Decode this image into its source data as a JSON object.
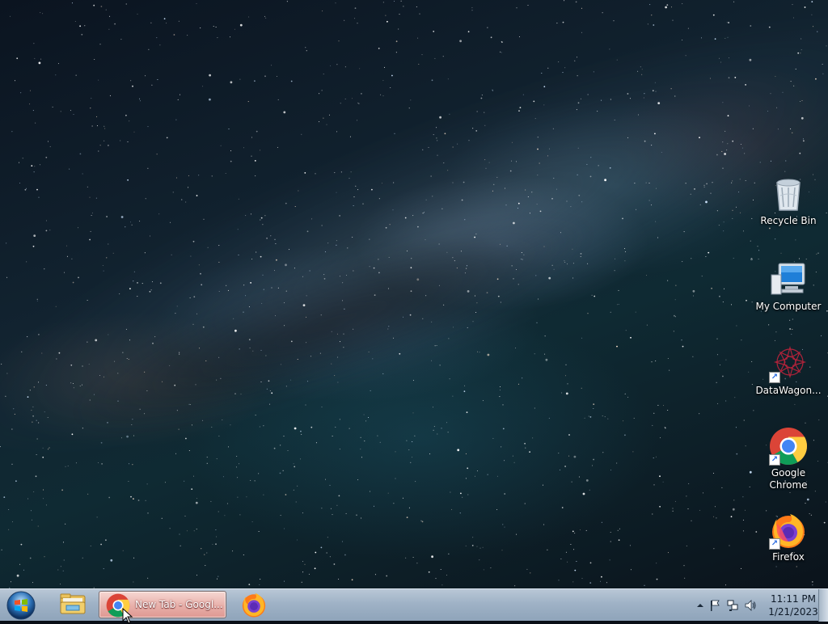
{
  "desktop": {
    "icons": [
      {
        "label": "Recycle Bin",
        "icon": "recycle-bin-icon"
      },
      {
        "label": "My Computer",
        "icon": "computer-icon"
      },
      {
        "label": "DataWagon...",
        "icon": "datawagon-icon",
        "shortcut": true
      },
      {
        "label": "Google Chrome",
        "icon": "chrome-icon",
        "shortcut": true
      },
      {
        "label": "Firefox",
        "icon": "firefox-icon",
        "shortcut": true
      }
    ]
  },
  "taskbar": {
    "start_icon": "windows-start-icon",
    "pinned": [
      {
        "name": "File Explorer",
        "icon": "folder-icon"
      },
      {
        "name": "New Tab - Googl...",
        "icon": "chrome-icon",
        "active": true
      },
      {
        "name": "Firefox",
        "icon": "firefox-icon"
      }
    ],
    "active_window_title": "New Tab - Googl...",
    "tray": {
      "icons": [
        "show-hidden-icons-arrow-icon",
        "action-center-flag-icon",
        "network-icon",
        "volume-icon"
      ],
      "time": "11:11 PM",
      "date": "1/21/2023"
    }
  },
  "colors": {
    "taskbar_top": "#b9c7d6",
    "taskbar_bottom": "#8fa4ba",
    "active_button": "#e8b0aa"
  }
}
